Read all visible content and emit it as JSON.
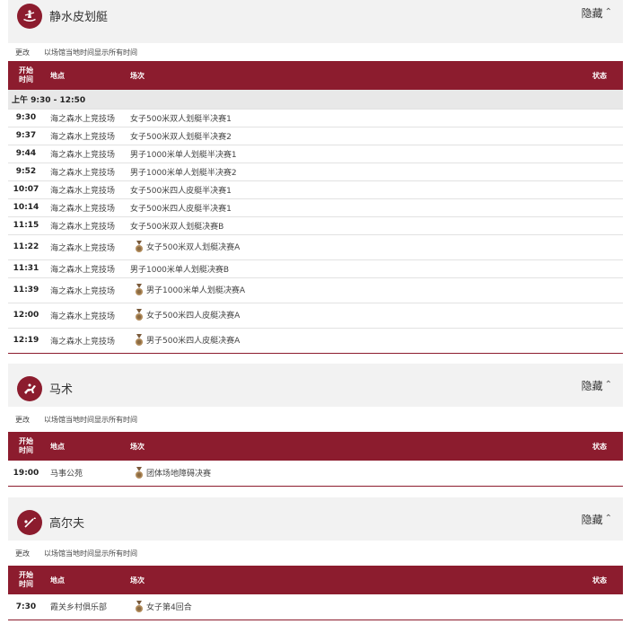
{
  "common": {
    "hide_label": "隐藏",
    "change_label": "更改",
    "tz_note": "以场馆当地时间显示所有时间",
    "col_time_1": "开始",
    "col_time_2": "时间",
    "col_venue": "地点",
    "col_event": "场次",
    "col_status": "状态"
  },
  "sections": [
    {
      "title": "静水皮划艇",
      "icon": "canoe-sprint-icon",
      "session": "上午  9:30 - 12:50",
      "rows": [
        {
          "time": "9:30",
          "venue": "海之森水上竞技场",
          "event": "女子500米双人划艇半决赛1",
          "medal": false
        },
        {
          "time": "9:37",
          "venue": "海之森水上竞技场",
          "event": "女子500米双人划艇半决赛2",
          "medal": false
        },
        {
          "time": "9:44",
          "venue": "海之森水上竞技场",
          "event": "男子1000米单人划艇半决赛1",
          "medal": false
        },
        {
          "time": "9:52",
          "venue": "海之森水上竞技场",
          "event": "男子1000米单人划艇半决赛2",
          "medal": false
        },
        {
          "time": "10:07",
          "venue": "海之森水上竞技场",
          "event": "女子500米四人皮艇半决赛1",
          "medal": false
        },
        {
          "time": "10:14",
          "venue": "海之森水上竞技场",
          "event": "女子500米四人皮艇半决赛1",
          "medal": false
        },
        {
          "time": "11:15",
          "venue": "海之森水上竞技场",
          "event": "女子500米双人划艇决赛B",
          "medal": false
        },
        {
          "time": "11:22",
          "venue": "海之森水上竞技场",
          "event": "女子500米双人划艇决赛A",
          "medal": true
        },
        {
          "time": "11:31",
          "venue": "海之森水上竞技场",
          "event": "男子1000米单人划艇决赛B",
          "medal": false
        },
        {
          "time": "11:39",
          "venue": "海之森水上竞技场",
          "event": "男子1000米单人划艇决赛A",
          "medal": true
        },
        {
          "time": "12:00",
          "venue": "海之森水上竞技场",
          "event": "女子500米四人皮艇决赛A",
          "medal": true
        },
        {
          "time": "12:19",
          "venue": "海之森水上竞技场",
          "event": "男子500米四人皮艇决赛A",
          "medal": true
        }
      ]
    },
    {
      "title": "马术",
      "icon": "equestrian-icon",
      "rows": [
        {
          "time": "19:00",
          "venue": "马事公苑",
          "event": "团体场地障碍决赛",
          "medal": true
        }
      ]
    },
    {
      "title": "高尔夫",
      "icon": "golf-icon",
      "rows": [
        {
          "time": "7:30",
          "venue": "霞关乡村俱乐部",
          "event": "女子第4回合",
          "medal": true
        }
      ]
    }
  ]
}
